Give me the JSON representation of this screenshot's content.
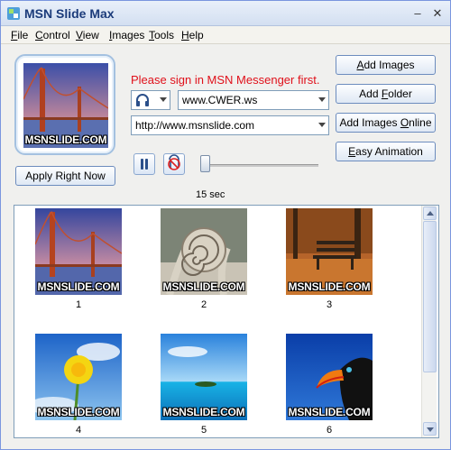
{
  "window": {
    "title": "MSN Slide Max"
  },
  "menu": [
    "File",
    "Control",
    "View",
    "Images",
    "Tools",
    "Help"
  ],
  "warning_text": "Please sign in MSN Messenger first.",
  "status_combo": {
    "value": "www.CWER.ws"
  },
  "url_combo": {
    "value": "http://www.msnslide.com"
  },
  "buttons": {
    "add_images": {
      "pre": "",
      "u": "A",
      "post": "dd Images"
    },
    "add_folder": {
      "pre": "Add ",
      "u": "F",
      "post": "older"
    },
    "add_images_online": {
      "pre": "Add Images ",
      "u": "O",
      "post": "nline"
    },
    "easy_animation": {
      "pre": "",
      "u": "E",
      "post": "asy Animation"
    },
    "apply_right_now": "Apply Right Now"
  },
  "interval": {
    "label": "15 sec",
    "seconds": 15
  },
  "watermark": "MSNSLIDE.COM",
  "gallery": {
    "items": [
      {
        "number": "1",
        "subject": "bridge"
      },
      {
        "number": "2",
        "subject": "snail"
      },
      {
        "number": "3",
        "subject": "bench"
      },
      {
        "number": "4",
        "subject": "dandelion"
      },
      {
        "number": "5",
        "subject": "island"
      },
      {
        "number": "6",
        "subject": "toucan"
      }
    ]
  }
}
